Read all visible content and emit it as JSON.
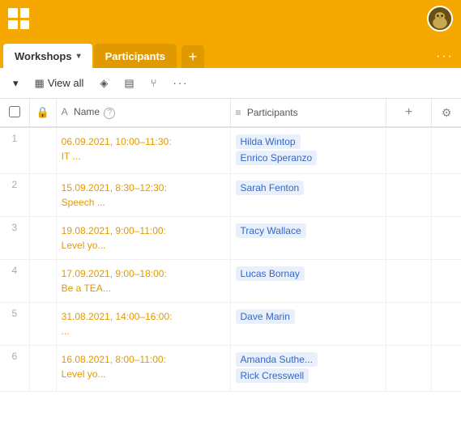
{
  "header": {
    "grid_icon_label": "grid-icon",
    "avatar_alt": "user avatar"
  },
  "tabs": {
    "workshops_label": "Workshops",
    "participants_label": "Participants",
    "add_tab_label": "+",
    "more_label": "···"
  },
  "toolbar": {
    "dropdown_arrow": "▾",
    "view_all_label": "View all",
    "filter_icon": "◈",
    "group_icon": "▤",
    "share_icon": "⑂",
    "more_label": "···"
  },
  "table": {
    "columns": [
      {
        "id": "checkbox",
        "label": ""
      },
      {
        "id": "lock",
        "label": ""
      },
      {
        "id": "name",
        "label": "Name"
      },
      {
        "id": "participants",
        "label": "Participants"
      },
      {
        "id": "add",
        "label": "+"
      },
      {
        "id": "settings",
        "label": "⚙"
      }
    ],
    "rows": [
      {
        "num": "1",
        "date": "06.09.2021, 10:00–11:30: IT ...",
        "participants": [
          "Hilda Wintop",
          "Enrico Speranzo"
        ]
      },
      {
        "num": "2",
        "date": "15.09.2021, 8:30–12:30: Speech ...",
        "participants": [
          "Sarah Fenton"
        ]
      },
      {
        "num": "3",
        "date": "19.08.2021, 9:00–11:00: Level yo...",
        "participants": [
          "Tracy Wallace"
        ]
      },
      {
        "num": "4",
        "date": "17.09.2021, 9:00–18:00: Be a TEA...",
        "participants": [
          "Lucas Bornay"
        ]
      },
      {
        "num": "5",
        "date": "31.08.2021, 14:00–16:00: ...",
        "participants": [
          "Dave Marin"
        ]
      },
      {
        "num": "6",
        "date": "16.08.2021, 8:00–11:00: Level yo...",
        "participants": [
          "Amanda Suthe...",
          "Rick Cresswell"
        ]
      }
    ]
  }
}
